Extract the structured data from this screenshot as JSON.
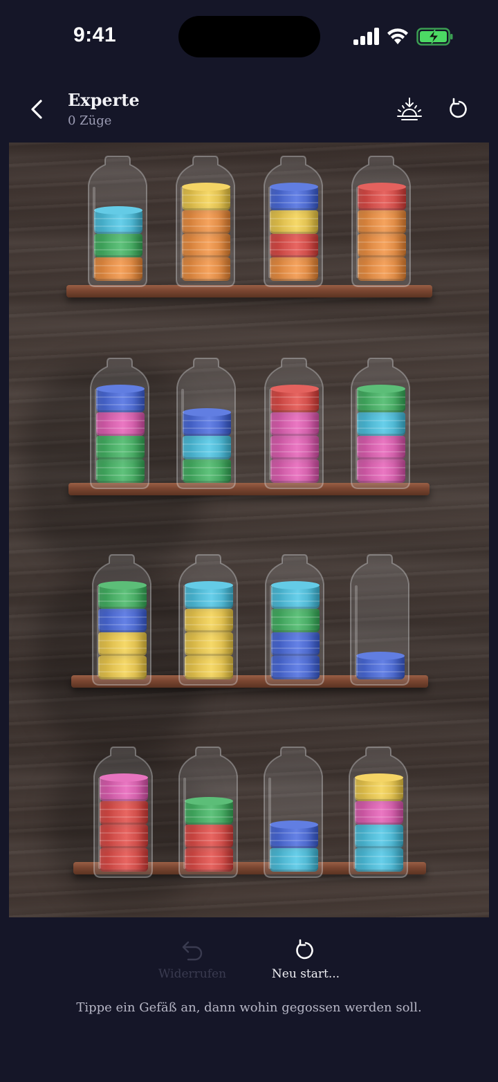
{
  "status_bar": {
    "time": "9:41"
  },
  "header": {
    "title": "Experte",
    "moves": "0 Züge"
  },
  "controls": {
    "undo_label": "Widerrufen",
    "restart_label": "Neu start..."
  },
  "instruction": "Tippe ein Gefäß an, dann wohin gegossen werden soll.",
  "colors": {
    "orange": "#e8832f",
    "green": "#34a853",
    "cyan": "#3db7d6",
    "yellow": "#e9c23c",
    "blue": "#3a5bd1",
    "red": "#d63a34",
    "pink": "#d94fa7"
  },
  "bottles": [
    [
      "orange",
      "green",
      "cyan"
    ],
    [
      "orange",
      "orange",
      "orange",
      "yellow"
    ],
    [
      "orange",
      "red",
      "yellow",
      "blue"
    ],
    [
      "orange",
      "orange",
      "orange",
      "red"
    ],
    [
      "green",
      "green",
      "pink",
      "blue"
    ],
    [
      "green",
      "cyan",
      "blue"
    ],
    [
      "pink",
      "pink",
      "pink",
      "red"
    ],
    [
      "pink",
      "pink",
      "cyan",
      "green"
    ],
    [
      "yellow",
      "yellow",
      "blue",
      "green"
    ],
    [
      "yellow",
      "yellow",
      "yellow",
      "cyan"
    ],
    [
      "blue",
      "blue",
      "green",
      "cyan"
    ],
    [
      "blue"
    ],
    [
      "red",
      "red",
      "red",
      "pink"
    ],
    [
      "red",
      "red",
      "green"
    ],
    [
      "cyan",
      "blue"
    ],
    [
      "cyan",
      "cyan",
      "pink",
      "yellow"
    ]
  ]
}
